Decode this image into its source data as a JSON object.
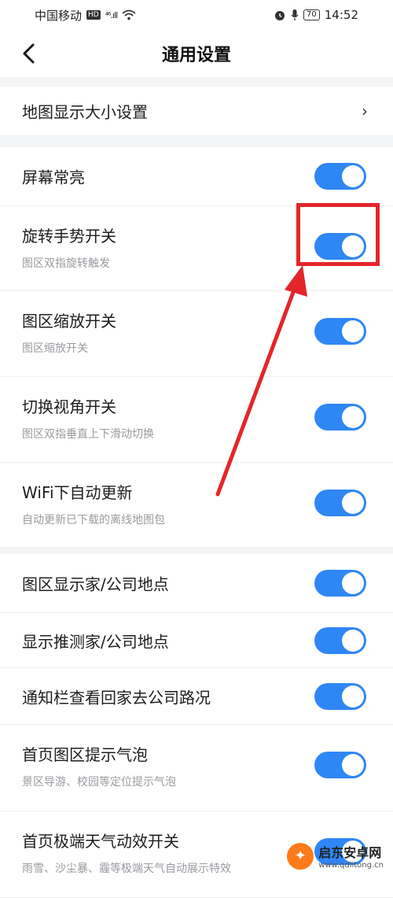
{
  "status_bar": {
    "carrier": "中国移动",
    "hd": "HD",
    "signal": "⁴⁶.ıll",
    "battery": "70",
    "time": "14:52"
  },
  "header": {
    "title": "通用设置"
  },
  "map_size": {
    "label": "地图显示大小设置",
    "chevron": "›"
  },
  "settings": [
    {
      "label": "屏幕常亮",
      "sub": "",
      "on": true
    },
    {
      "label": "旋转手势开关",
      "sub": "图区双指旋转触发",
      "on": true
    },
    {
      "label": "图区缩放开关",
      "sub": "图区缩放开关",
      "on": true
    },
    {
      "label": "切换视角开关",
      "sub": "图区双指垂直上下滑动切换",
      "on": true
    },
    {
      "label": "WiFi下自动更新",
      "sub": "自动更新已下载的离线地图包",
      "on": true
    },
    {
      "label": "图区显示家/公司地点",
      "sub": "",
      "on": true
    },
    {
      "label": "显示推测家/公司地点",
      "sub": "",
      "on": true
    },
    {
      "label": "通知栏查看回家去公司路况",
      "sub": "",
      "on": true
    },
    {
      "label": "首页图区提示气泡",
      "sub": "景区导游、校园等定位提示气泡",
      "on": true
    },
    {
      "label": "首页极端天气动效开关",
      "sub": "雨雪、沙尘暴、霾等极端天气自动展示特效",
      "on": true
    }
  ],
  "watermark": {
    "title": "启东安卓网",
    "url": "www.qdlitong.cn"
  },
  "colors": {
    "toggle_on": "#2f86f5",
    "annotation": "#e3262b"
  }
}
